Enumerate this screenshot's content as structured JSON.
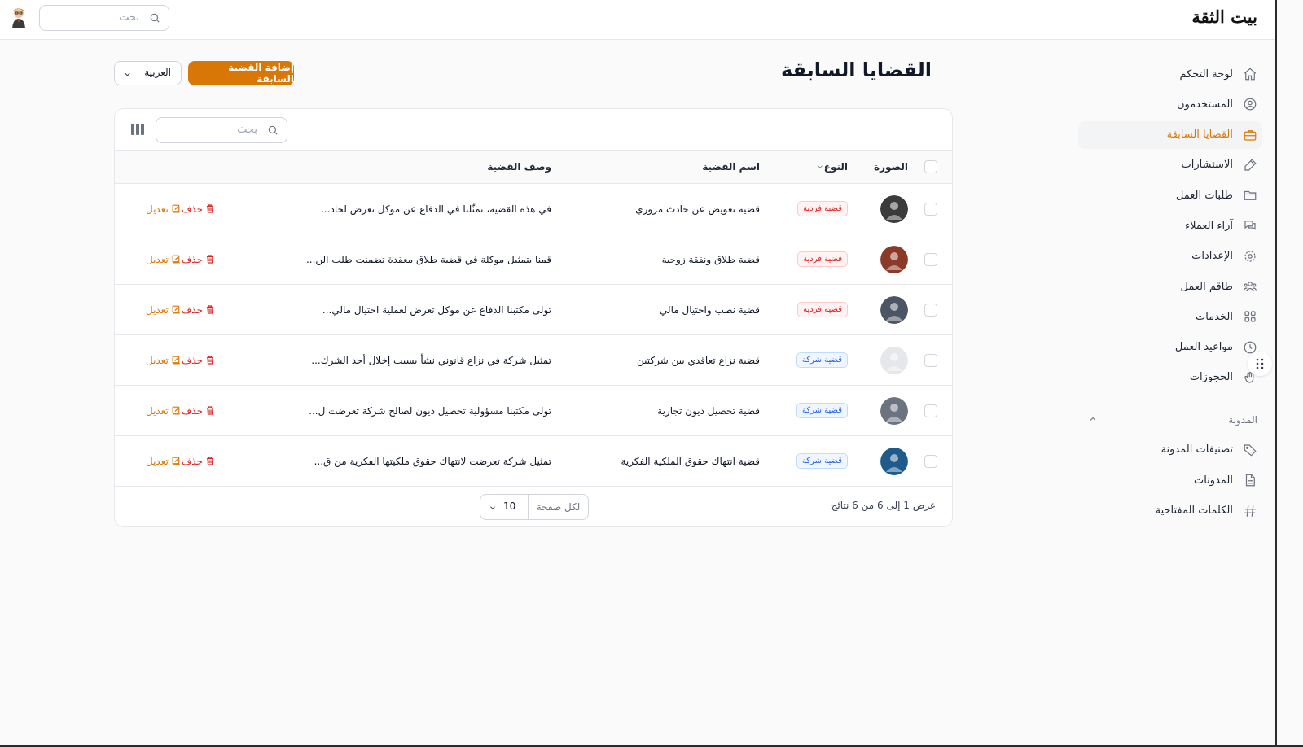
{
  "app": {
    "logo": "بيت الثقة",
    "search": {
      "placeholder": "بحث"
    }
  },
  "sidebar": {
    "items": [
      {
        "label": "لوحة التحكم",
        "icon": "home-icon",
        "active": false
      },
      {
        "label": "المستخدمون",
        "icon": "user-circle-icon",
        "active": false
      },
      {
        "label": "القضايا السابقة",
        "icon": "briefcase-icon",
        "active": true
      },
      {
        "label": "الاستشارات",
        "icon": "pencil-square-icon",
        "active": false
      },
      {
        "label": "طلبات العمل",
        "icon": "folder-icon",
        "active": false
      },
      {
        "label": "آراء العملاء",
        "icon": "chat-bubbles-icon",
        "active": false
      },
      {
        "label": "الإعدادات",
        "icon": "cog-icon",
        "active": false
      },
      {
        "label": "طاقم العمل",
        "icon": "user-group-icon",
        "active": false
      },
      {
        "label": "الخدمات",
        "icon": "squares-icon",
        "active": false
      },
      {
        "label": "مواعيد العمل",
        "icon": "clock-icon",
        "active": false
      },
      {
        "label": "الحجوزات",
        "icon": "hand-icon",
        "active": false
      }
    ],
    "blog_group": {
      "label": "المدونة",
      "items": [
        {
          "label": "تصنيفات المدونة",
          "icon": "tag-icon"
        },
        {
          "label": "المدونات",
          "icon": "document-icon"
        },
        {
          "label": "الكلمات المفتاحية",
          "icon": "hashtag-icon"
        }
      ]
    }
  },
  "page": {
    "title": "القضايا السابقة",
    "add_button": "إضافة القضية السابقة",
    "language": "العربية"
  },
  "table": {
    "search_placeholder": "بحث",
    "columns": {
      "image": "الصورة",
      "type": "النوع",
      "name": "اسم القضية",
      "description": "وصف القضية"
    },
    "actions": {
      "edit": "تعديل",
      "delete": "حذف"
    },
    "rows": [
      {
        "type": "قضية فردية",
        "type_kind": "fardia",
        "name": "قضية تعويض عن حادث مروري",
        "description": "في هذه القضية، تمثّلنا في الدفاع عن موكل تعرض لحاد...",
        "thumb_color": "#3b3b3b"
      },
      {
        "type": "قضية فردية",
        "type_kind": "fardia",
        "name": "قضية طلاق ونفقة زوجية",
        "description": "قمنا بتمثيل موكلة في قضية طلاق معقدة تضمنت طلب الن...",
        "thumb_color": "#8b3a2a"
      },
      {
        "type": "قضية فردية",
        "type_kind": "fardia",
        "name": "قضية نصب واحتيال مالي",
        "description": "تولى مكتبنا الدفاع عن موكل تعرض لعملية احتيال مالي...",
        "thumb_color": "#4b5563"
      },
      {
        "type": "قضية شركة",
        "type_kind": "sharika",
        "name": "قضية نزاع تعاقدي بين شركتين",
        "description": "تمثيل شركة في نزاع قانوني نشأ بسبب إخلال أحد الشرك...",
        "thumb_color": "#e5e7eb"
      },
      {
        "type": "قضية شركة",
        "type_kind": "sharika",
        "name": "قضية تحصيل ديون تجارية",
        "description": "تولى مكتبنا مسؤولية تحصيل ديون لصالح شركة تعرضت ل...",
        "thumb_color": "#6b7280"
      },
      {
        "type": "قضية شركة",
        "type_kind": "sharika",
        "name": "قضية انتهاك حقوق الملكية الفكرية",
        "description": "تمثيل شركة تعرضت لانتهاك حقوق ملكيتها الفكرية من ق...",
        "thumb_color": "#1e5a8a"
      }
    ],
    "footer": {
      "summary": "عرض 1 إلى 6 من 6 نتائج",
      "per_page_label": "لكل صفحة",
      "per_page_value": "10"
    }
  },
  "colors": {
    "accent": "#d97706",
    "danger": "#dc2626",
    "info": "#2563eb"
  }
}
